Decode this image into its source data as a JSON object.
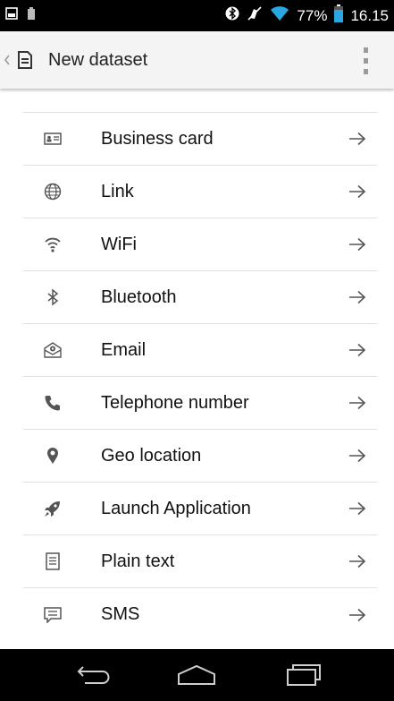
{
  "status_bar": {
    "battery_percent": "77%",
    "time": "16.15",
    "left_icons": [
      "gallery-icon",
      "sim-battery-icon"
    ],
    "right_icons": [
      "bluetooth-icon",
      "mute-icon",
      "wifi-icon",
      "battery-icon"
    ]
  },
  "app_bar": {
    "title": "New dataset",
    "icon": "document-icon"
  },
  "items": [
    {
      "label": "Business card",
      "icon": "business-card-icon"
    },
    {
      "label": "Link",
      "icon": "globe-icon"
    },
    {
      "label": "WiFi",
      "icon": "wifi-icon"
    },
    {
      "label": "Bluetooth",
      "icon": "bluetooth-icon"
    },
    {
      "label": "Email",
      "icon": "email-icon"
    },
    {
      "label": "Telephone number",
      "icon": "phone-icon"
    },
    {
      "label": "Geo location",
      "icon": "location-pin-icon"
    },
    {
      "label": "Launch Application",
      "icon": "rocket-icon"
    },
    {
      "label": "Plain text",
      "icon": "text-document-icon"
    },
    {
      "label": "SMS",
      "icon": "sms-icon"
    }
  ],
  "nav_bar": {
    "buttons": [
      "back-icon",
      "home-icon",
      "recents-icon"
    ]
  }
}
